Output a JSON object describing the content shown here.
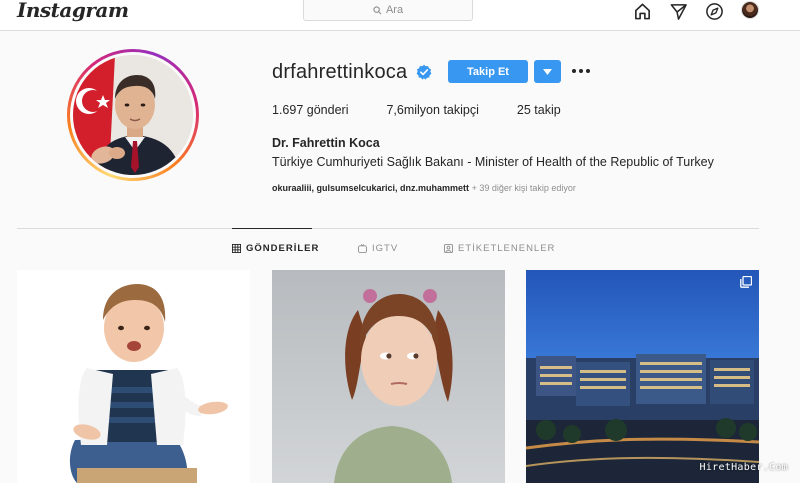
{
  "topbar": {
    "logo": "Instagram",
    "search_placeholder": "Ara",
    "nav_icons": [
      "home-icon",
      "direct-icon",
      "explore-icon",
      "activity-icon",
      "profile-avatar"
    ]
  },
  "profile": {
    "username": "drfahrettinkoca",
    "verified": true,
    "follow_label": "Takip Et",
    "stats": {
      "posts": "1.697",
      "posts_label": "gönderi",
      "followers": "7,6milyon",
      "followers_label": "takipçi",
      "following": "25",
      "following_label": "takip"
    },
    "full_name": "Dr. Fahrettin Koca",
    "bio": "Türkiye Cumhuriyeti Sağlık Bakanı - Minister of Health of the Republic of Turkey",
    "followed_by_names": "okuraaliii, gulsumselcukarici, dnz.muhammett",
    "followed_by_more": " + 39 diğer kişi takip ediyor"
  },
  "tabs": [
    {
      "label": "GÖNDERİLER",
      "active": true
    },
    {
      "label": "IGTV",
      "active": false
    },
    {
      "label": "ETİKETLENENLER",
      "active": false
    }
  ],
  "colors": {
    "accent": "#3897f0",
    "text": "#262626",
    "muted": "#8e8e8e",
    "border": "#dbdbdb"
  },
  "watermark": "HiretHaber.Com"
}
